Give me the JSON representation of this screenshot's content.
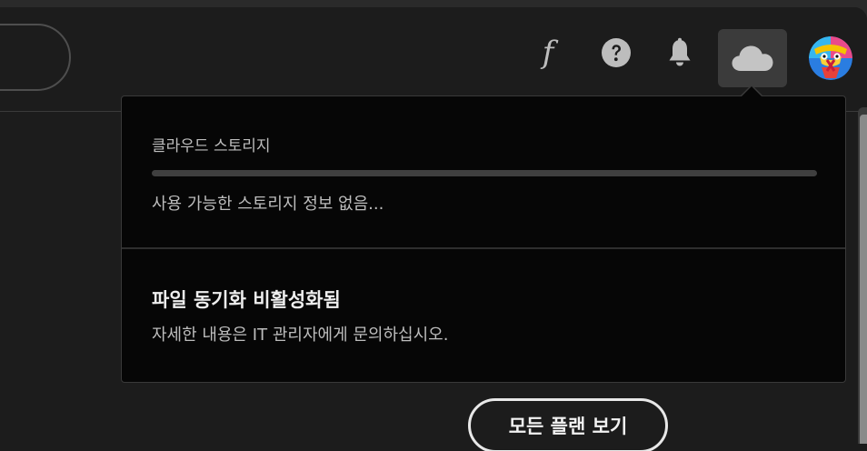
{
  "header": {
    "icons": [
      "function-icon",
      "help-icon",
      "bell-icon",
      "cloud-icon",
      "avatar"
    ],
    "fx_glyph": "f"
  },
  "storage_popover": {
    "title": "클라우드 스토리지",
    "usage_fraction": 0,
    "status": "사용 가능한 스토리지 정보 없음...",
    "sync_title": "파일 동기화 비활성화됨",
    "sync_description": "자세한 내용은 IT 관리자에게 문의하십시오."
  },
  "main": {
    "view_plans_label": "모든 플랜 보기"
  },
  "colors": {
    "accent_cloud_button_bg": "#3b3b3b",
    "popover_bg": "#060606",
    "window_bg": "#1c1c1c"
  }
}
